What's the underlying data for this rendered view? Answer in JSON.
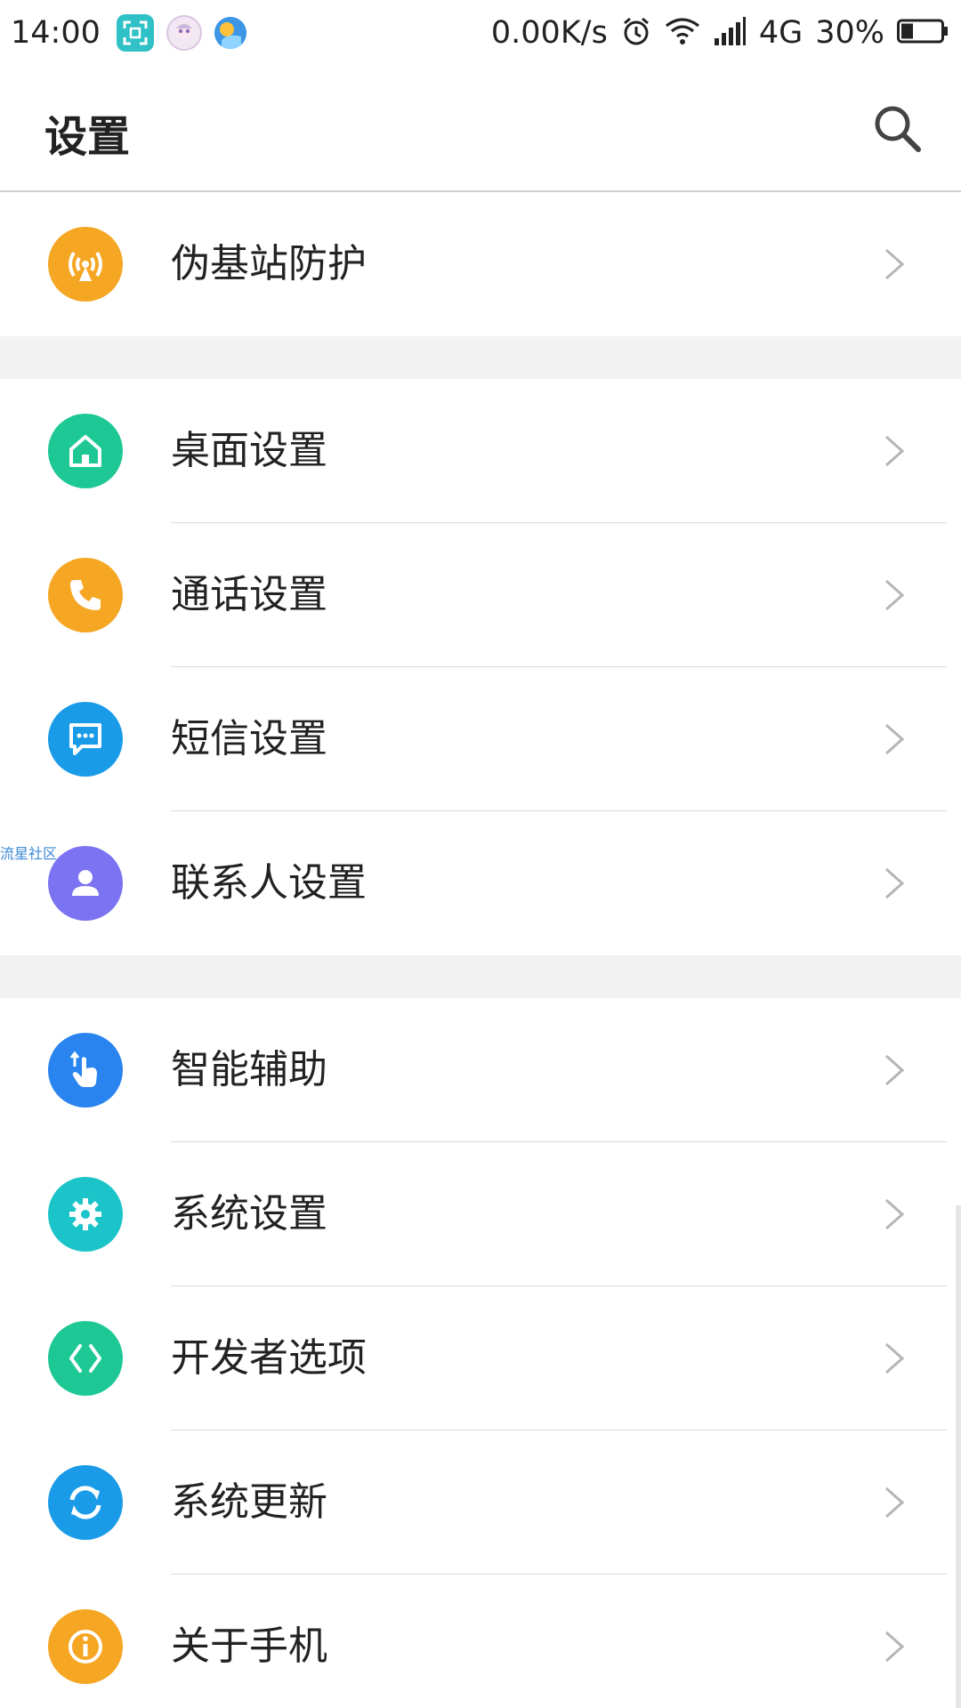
{
  "status_bar": {
    "time": "14:00",
    "network_speed": "0.00K/s",
    "network_type": "4G",
    "battery": "30%",
    "battery_level": 0.3,
    "icons": [
      "scan-icon",
      "avatar-icon",
      "weather-icon",
      "alarm-icon",
      "wifi-icon",
      "signal-icon",
      "battery-icon"
    ]
  },
  "header": {
    "title": "设置"
  },
  "sections": [
    {
      "items": [
        {
          "label": "伪基站防护",
          "icon": "fake-base-station-icon",
          "color": "#f5a623"
        }
      ]
    },
    {
      "items": [
        {
          "label": "桌面设置",
          "icon": "home-icon",
          "color": "#1dc894"
        },
        {
          "label": "通话设置",
          "icon": "phone-icon",
          "color": "#f5a623"
        },
        {
          "label": "短信设置",
          "icon": "message-icon",
          "color": "#1a9be8"
        },
        {
          "label": "联系人设置",
          "icon": "contact-icon",
          "color": "#7b73f2"
        }
      ]
    },
    {
      "items": [
        {
          "label": "智能辅助",
          "icon": "gesture-icon",
          "color": "#2a84ef"
        },
        {
          "label": "系统设置",
          "icon": "gear-icon",
          "color": "#1bc4c9"
        },
        {
          "label": "开发者选项",
          "icon": "code-icon",
          "color": "#1dc894"
        },
        {
          "label": "系统更新",
          "icon": "refresh-icon",
          "color": "#1a9be8"
        },
        {
          "label": "关于手机",
          "icon": "info-icon",
          "color": "#f5a623"
        }
      ]
    }
  ],
  "watermark": "流星社区"
}
